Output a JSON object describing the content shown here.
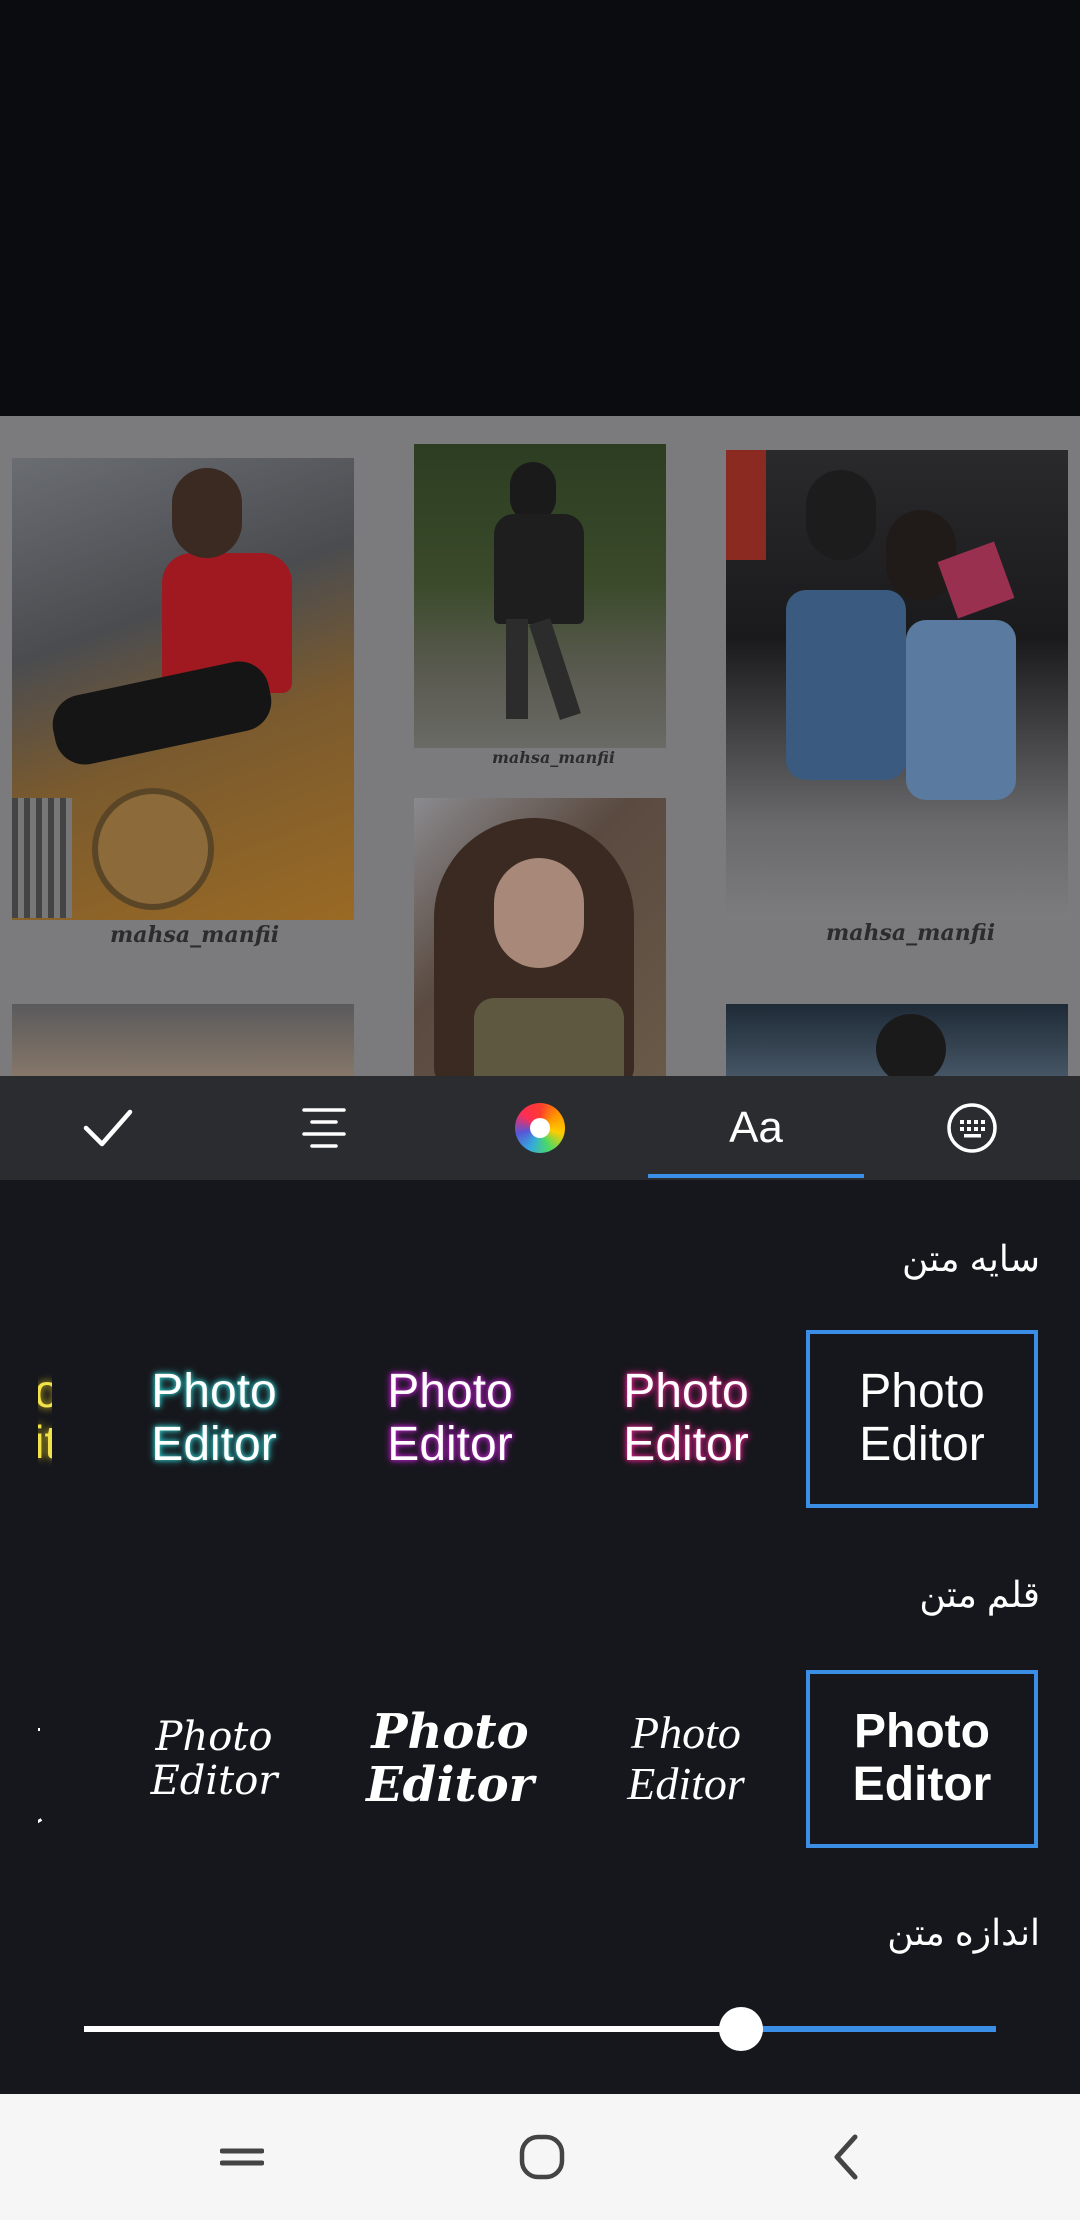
{
  "canvas": {
    "captions": [
      "mahsa_manfii",
      "mahsa_manfii",
      "mahsa_manfii"
    ]
  },
  "toolbar": {
    "items": [
      {
        "name": "confirm",
        "icon": "check-icon"
      },
      {
        "name": "align",
        "icon": "align-center-icon"
      },
      {
        "name": "color",
        "icon": "color-wheel-icon"
      },
      {
        "name": "font",
        "icon": "font-icon",
        "label": "Aa",
        "selected": true
      },
      {
        "name": "keyboard",
        "icon": "keyboard-icon"
      }
    ]
  },
  "panel": {
    "shadow_section_title": "سایه متن",
    "font_section_title": "قلم متن",
    "size_section_title": "اندازه متن",
    "shadow_styles": [
      {
        "line1": "Photo",
        "line2": "Editor",
        "glow": "#2ec4c4"
      },
      {
        "line1": "Photo",
        "line2": "Editor",
        "glow": "#c01fd0"
      },
      {
        "line1": "Photo",
        "line2": "Editor",
        "glow": "#e0208c"
      },
      {
        "line1": "Photo",
        "line2": "Editor",
        "glow": "none",
        "selected": true
      }
    ],
    "font_styles": [
      {
        "text": "Photo Editor",
        "style": "script-thin"
      },
      {
        "line1": "Photo",
        "line2": "Editor",
        "style": "script-bold"
      },
      {
        "line1": "Photo",
        "line2": "Editor",
        "style": "script-hand"
      },
      {
        "line1": "Photo",
        "line2": "Editor",
        "style": "sans-bold",
        "selected": true
      }
    ],
    "text_size_fraction": 0.72
  },
  "colors": {
    "accent": "#3a8ee6",
    "panel_bg": "#16171c",
    "toolbar_bg": "#2b2c30"
  },
  "navbar": {
    "buttons": [
      "recent-apps-icon",
      "home-icon",
      "back-icon"
    ]
  }
}
